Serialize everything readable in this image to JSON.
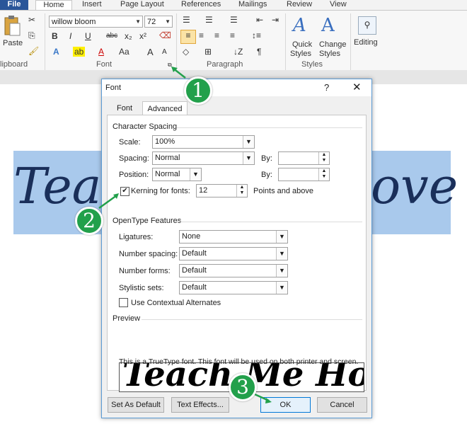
{
  "ribbon": {
    "tabs": [
      "File",
      "Home",
      "Insert",
      "Page Layout",
      "References",
      "Mailings",
      "Review",
      "View"
    ],
    "clipboard": {
      "paste_label": "Paste",
      "group_label": "lipboard"
    },
    "font": {
      "name_value": "willow bloom",
      "size_value": "72",
      "group_label": "Font",
      "bold": "B",
      "italic": "I",
      "underline": "U",
      "strike": "abc",
      "subscript": "x₂",
      "superscript": "x²",
      "grow": "A",
      "shrink": "A",
      "case": "Aa"
    },
    "paragraph": {
      "group_label": "Paragraph"
    },
    "styles": {
      "quick_label_1": "Quick",
      "quick_label_2": "Styles",
      "change_label_1": "Change",
      "change_label_2": "Styles",
      "group_label": "Styles"
    },
    "editing": {
      "label": "Editing"
    }
  },
  "document": {
    "left_text": "Teach",
    "right_text": "ove"
  },
  "dialog": {
    "title": "Font",
    "help": "?",
    "close": "✕",
    "tabs": [
      {
        "label": "Font"
      },
      {
        "label": "Advanced"
      }
    ],
    "character_spacing": {
      "section": "Character Spacing",
      "scale_label": "Scale:",
      "scale_value": "100%",
      "spacing_label": "Spacing:",
      "spacing_value": "Normal",
      "by_label_1": "By:",
      "by_value_1": "",
      "position_label": "Position:",
      "position_value": "Normal",
      "by_label_2": "By:",
      "by_value_2": "",
      "kerning_label": "Kerning for fonts:",
      "kerning_checked": true,
      "kerning_value": "12",
      "points_label": "Points and above"
    },
    "opentype": {
      "section": "OpenType Features",
      "ligatures_label": "Ligatures:",
      "ligatures_value": "None",
      "number_spacing_label": "Number spacing:",
      "number_spacing_value": "Default",
      "number_forms_label": "Number forms:",
      "number_forms_value": "Default",
      "stylistic_sets_label": "Stylistic sets:",
      "stylistic_sets_value": "Default",
      "contextual_label": "Use Contextual Alternates",
      "contextual_checked": false
    },
    "preview": {
      "section": "Preview",
      "sample": "Teach Me How",
      "note": "This is a TrueType font. This font will be used on both printer and screen."
    },
    "buttons": {
      "set_default": "Set As Default",
      "text_effects": "Text Effects...",
      "ok": "OK",
      "cancel": "Cancel"
    }
  },
  "callouts": [
    "1",
    "2",
    "3"
  ],
  "colors": {
    "callout": "#22a04b",
    "highlight": "#a9c9ec",
    "file_tab": "#2a5699"
  }
}
